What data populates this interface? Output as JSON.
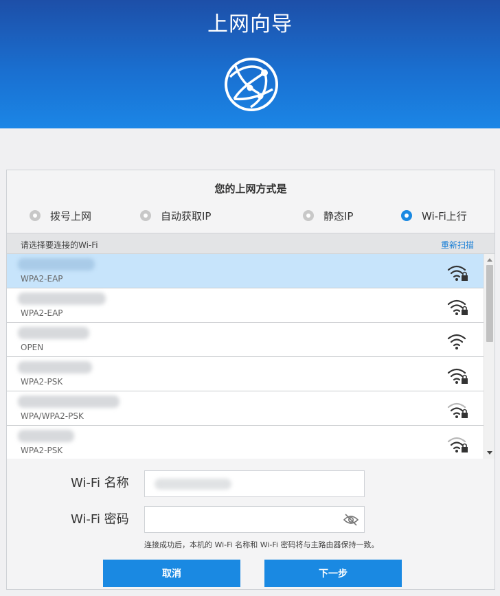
{
  "header": {
    "title": "上网向导"
  },
  "card": {
    "title": "您的上网方式是",
    "options": [
      {
        "label": "拨号上网",
        "checked": false
      },
      {
        "label": "自动获取IP",
        "checked": false
      },
      {
        "label": "静态IP",
        "checked": false
      },
      {
        "label": "Wi-Fi上行",
        "checked": true
      }
    ]
  },
  "list": {
    "header_label": "请选择要连接的Wi-Fi",
    "rescan_label": "重新扫描",
    "items": [
      {
        "security": "WPA2-EAP",
        "locked": true,
        "signal": "strong"
      },
      {
        "security": "WPA2-EAP",
        "locked": true,
        "signal": "strong"
      },
      {
        "security": "OPEN",
        "locked": false,
        "signal": "strong"
      },
      {
        "security": "WPA2-PSK",
        "locked": true,
        "signal": "strong"
      },
      {
        "security": "WPA/WPA2-PSK",
        "locked": true,
        "signal": "weak"
      },
      {
        "security": "WPA2-PSK",
        "locked": true,
        "signal": "weak"
      }
    ]
  },
  "form": {
    "ssid_label": "Wi-Fi 名称",
    "password_label": "Wi-Fi 密码",
    "hint": "连接成功后，本机的 Wi-Fi 名称和 Wi-Fi 密码将与主路由器保持一致。",
    "cancel_label": "取消",
    "next_label": "下一步"
  },
  "colors": {
    "accent": "#1a89e2",
    "header_top": "#1d4fa8",
    "header_bottom": "#1b86e6",
    "selected_row": "#c7e4fb"
  }
}
